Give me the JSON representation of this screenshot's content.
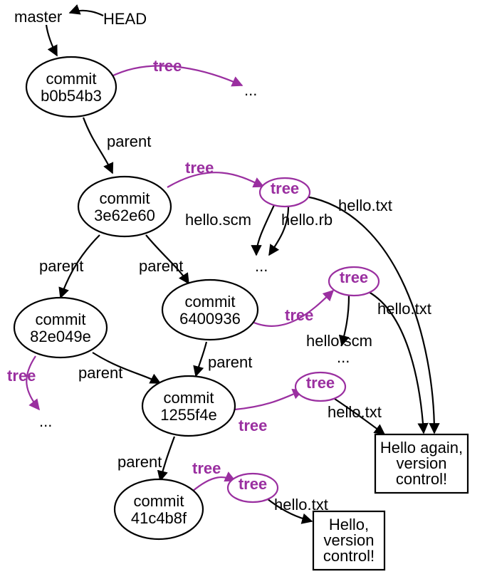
{
  "refs": {
    "master": "master",
    "head": "HEAD"
  },
  "commits": {
    "c1": {
      "label": "commit",
      "hash": "b0b54b3"
    },
    "c2": {
      "label": "commit",
      "hash": "3e62e60"
    },
    "c3": {
      "label": "commit",
      "hash": "6400936"
    },
    "c4": {
      "label": "commit",
      "hash": "82e049e"
    },
    "c5": {
      "label": "commit",
      "hash": "1255f4e"
    },
    "c6": {
      "label": "commit",
      "hash": "41c4b8f"
    }
  },
  "tree_word": "tree",
  "parent_word": "parent",
  "ellipsis": "...",
  "files": {
    "hello_scm": "hello.scm",
    "hello_rb": "hello.rb",
    "hello_txt": "hello.txt"
  },
  "blobs": {
    "b1_l1": "Hello again,",
    "b1_l2": "version",
    "b1_l3": "control!",
    "b2_l1": "Hello,",
    "b2_l2": "version",
    "b2_l3": "control!"
  }
}
